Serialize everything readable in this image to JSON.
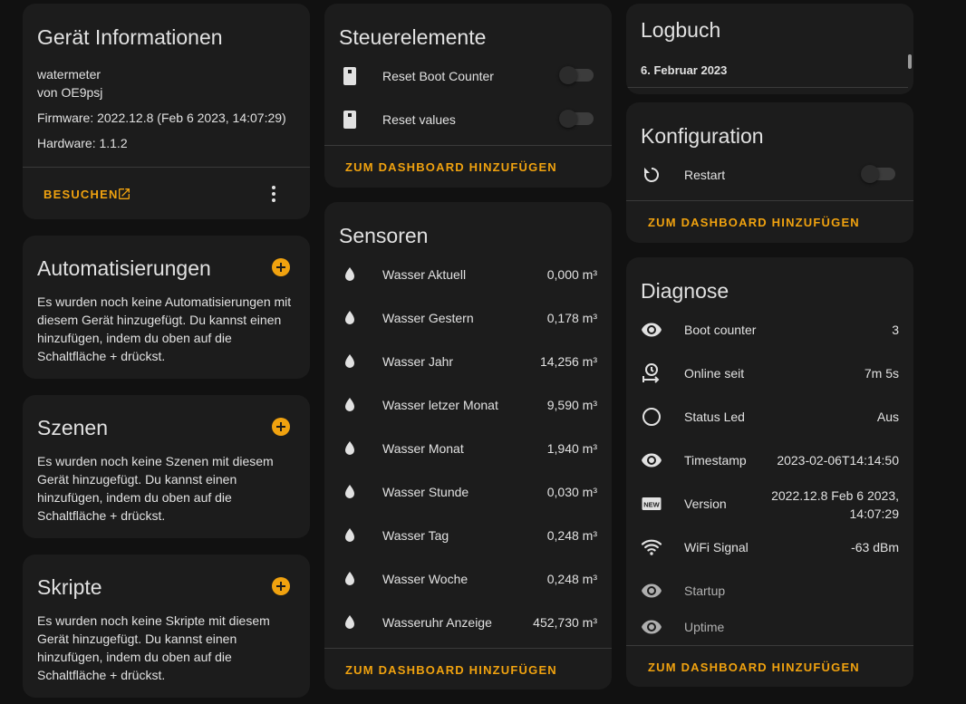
{
  "device_info": {
    "title": "Gerät Informationen",
    "model": "watermeter",
    "manufacturer": "von OE9psj",
    "firmware": "Firmware: 2022.12.8 (Feb 6 2023, 14:07:29)",
    "hardware": "Hardware: 1.1.2",
    "visit_label": "BESUCHEN"
  },
  "automations": {
    "title": "Automatisierungen",
    "text": "Es wurden noch keine Automatisierungen mit diesem Gerät hinzugefügt. Du kannst einen hinzufügen, indem du oben auf die Schaltfläche + drückst."
  },
  "scenes": {
    "title": "Szenen",
    "text": "Es wurden noch keine Szenen mit diesem Gerät hinzugefügt. Du kannst einen hinzufügen, indem du oben auf die Schaltfläche + drückst."
  },
  "scripts": {
    "title": "Skripte",
    "text": "Es wurden noch keine Skripte mit diesem Gerät hinzugefügt. Du kannst einen hinzufügen, indem du oben auf die Schaltfläche + drückst."
  },
  "controls": {
    "title": "Steuerelemente",
    "items": [
      {
        "label": "Reset Boot Counter",
        "icon": "button-icon",
        "state": "off"
      },
      {
        "label": "Reset values",
        "icon": "button-icon",
        "state": "off"
      }
    ],
    "add_label": "ZUM DASHBOARD HINZUFÜGEN"
  },
  "sensors": {
    "title": "Sensoren",
    "items": [
      {
        "label": "Wasser Aktuell",
        "value": "0,000 m³",
        "icon": "water-drop-icon"
      },
      {
        "label": "Wasser Gestern",
        "value": "0,178 m³",
        "icon": "water-drop-icon"
      },
      {
        "label": "Wasser Jahr",
        "value": "14,256 m³",
        "icon": "water-drop-icon"
      },
      {
        "label": "Wasser letzer Monat",
        "value": "9,590 m³",
        "icon": "water-drop-icon"
      },
      {
        "label": "Wasser Monat",
        "value": "1,940 m³",
        "icon": "water-drop-icon"
      },
      {
        "label": "Wasser Stunde",
        "value": "0,030 m³",
        "icon": "water-drop-icon"
      },
      {
        "label": "Wasser Tag",
        "value": "0,248 m³",
        "icon": "water-drop-icon"
      },
      {
        "label": "Wasser Woche",
        "value": "0,248 m³",
        "icon": "water-drop-icon"
      },
      {
        "label": "Wasseruhr Anzeige",
        "value": "452,730 m³",
        "icon": "water-drop-icon"
      }
    ],
    "add_label": "ZUM DASHBOARD HINZUFÜGEN"
  },
  "logbook": {
    "title": "Logbuch",
    "date": "6. Februar 2023"
  },
  "configuration": {
    "title": "Konfiguration",
    "items": [
      {
        "label": "Restart",
        "icon": "restart-icon",
        "state": "off"
      }
    ],
    "add_label": "ZUM DASHBOARD HINZUFÜGEN"
  },
  "diagnostics": {
    "title": "Diagnose",
    "items": [
      {
        "label": "Boot counter",
        "value": "3",
        "icon": "eye-icon"
      },
      {
        "label": "Online seit",
        "value": "7m 5s",
        "icon": "timer-icon"
      },
      {
        "label": "Status Led",
        "value": "Aus",
        "icon": "circle-outline-icon"
      },
      {
        "label": "Timestamp",
        "value": "2023-02-06T14:14:50",
        "icon": "eye-icon"
      },
      {
        "label": "Version",
        "value_line1": "2022.12.8 Feb 6 2023,",
        "value_line2": "14:07:29",
        "icon": "new-box-icon"
      },
      {
        "label": "WiFi Signal",
        "value": "-63 dBm",
        "icon": "wifi-icon"
      },
      {
        "label": "Startup",
        "value": "",
        "icon": "eye-icon"
      },
      {
        "label": "Uptime",
        "value": "",
        "icon": "eye-icon"
      }
    ],
    "add_label": "ZUM DASHBOARD HINZUFÜGEN"
  },
  "colors": {
    "background": "#111111",
    "card": "#1c1c1c",
    "accent": "#f0a20f",
    "text": "#e1e1e1"
  }
}
